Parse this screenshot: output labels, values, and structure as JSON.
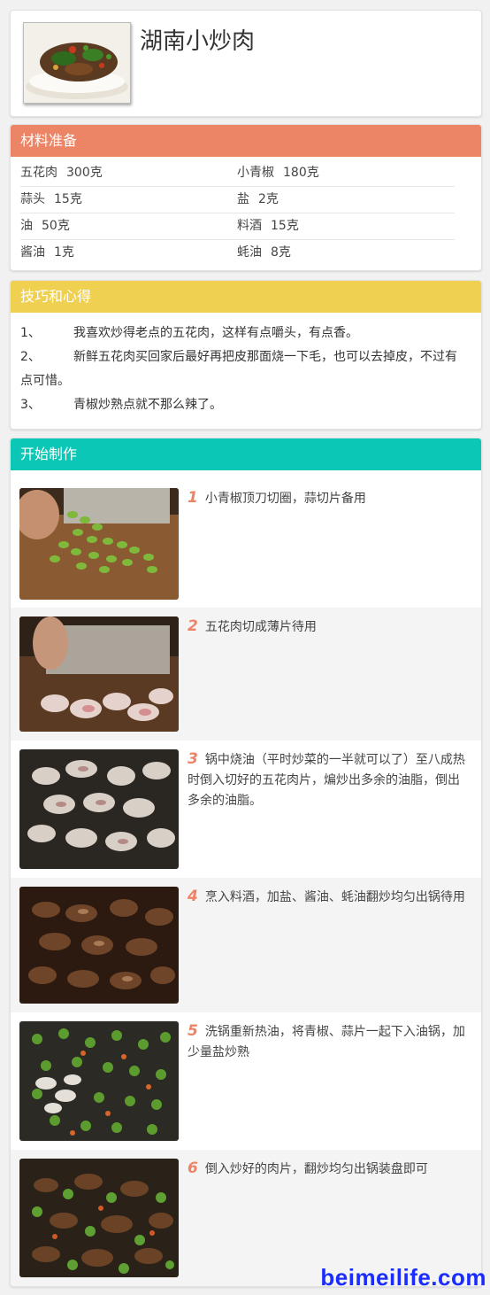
{
  "recipe": {
    "title": "湖南小炒肉"
  },
  "ingredients": {
    "heading": "材料准备",
    "items": [
      {
        "name": "五花肉",
        "qty": "300克"
      },
      {
        "name": "小青椒",
        "qty": "180克"
      },
      {
        "name": "蒜头",
        "qty": "15克"
      },
      {
        "name": "盐",
        "qty": "2克"
      },
      {
        "name": "油",
        "qty": "50克"
      },
      {
        "name": "料酒",
        "qty": "15克"
      },
      {
        "name": "酱油",
        "qty": "1克"
      },
      {
        "name": "蚝油",
        "qty": "8克"
      }
    ]
  },
  "tips": {
    "heading": "技巧和心得",
    "items": [
      {
        "num": "1、",
        "text": "我喜欢炒得老点的五花肉，这样有点嚼头，有点香。"
      },
      {
        "num": "2、",
        "text": "新鲜五花肉买回家后最好再把皮那面烧一下毛，也可以去掉皮，不过有点可惜。"
      },
      {
        "num": "3、",
        "text": "青椒炒熟点就不那么辣了。"
      }
    ]
  },
  "steps": {
    "heading": "开始制作",
    "items": [
      {
        "num": "1",
        "text": "小青椒顶刀切圈，蒜切片备用"
      },
      {
        "num": "2",
        "text": "五花肉切成薄片待用"
      },
      {
        "num": "3",
        "text": "锅中烧油（平时炒菜的一半就可以了）至八成热时倒入切好的五花肉片，煸炒出多余的油脂，倒出多余的油脂。"
      },
      {
        "num": "4",
        "text": "烹入料酒，加盐、酱油、蚝油翻炒均匀出锅待用"
      },
      {
        "num": "5",
        "text": "洗锅重新热油，将青椒、蒜片一起下入油锅，加少量盐炒熟"
      },
      {
        "num": "6",
        "text": "倒入炒好的肉片，翻炒均匀出锅装盘即可"
      }
    ]
  },
  "watermark": "beimeilife.com",
  "colors": {
    "ingredients_header": "#ec8466",
    "tips_header": "#f0d050",
    "steps_header": "#0ac8b5",
    "step_number": "#ec8466",
    "watermark": "#1b2cff"
  }
}
